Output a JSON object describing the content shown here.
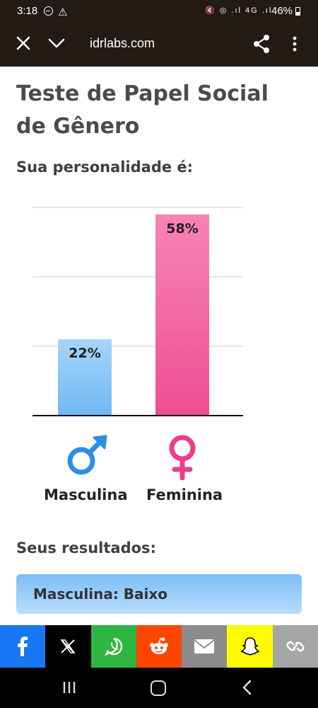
{
  "status_bar": {
    "time": "3:18",
    "alert_icon": "⚠",
    "system_icons": "🔇 ◎ .ıl 4G .ıl",
    "battery": "46%"
  },
  "browser": {
    "url": "idrlabs.com"
  },
  "page": {
    "title": "Teste de Papel Social de Gênero",
    "subtitle": "Sua personalidade é:",
    "results_heading": "Seus resultados:",
    "result_card": "Masculina: Baixo"
  },
  "chart_data": {
    "type": "bar",
    "categories": [
      "Masculina",
      "Feminina"
    ],
    "values": [
      22,
      58
    ],
    "value_labels": [
      "22%",
      "58%"
    ],
    "ylim": [
      0,
      100
    ],
    "grid": true,
    "bar_colors": [
      "#7fc3f7",
      "#f2669f"
    ],
    "icons": [
      "male-symbol-icon",
      "female-symbol-icon"
    ]
  },
  "share_bar": [
    {
      "name": "facebook",
      "icon": "f",
      "color": "#1877f2"
    },
    {
      "name": "x",
      "icon": "𝕏",
      "color": "#000000"
    },
    {
      "name": "whatsapp",
      "icon": "whatsapp-icon",
      "color": "#2db742"
    },
    {
      "name": "reddit",
      "icon": "reddit-icon",
      "color": "#ff4500"
    },
    {
      "name": "email",
      "icon": "envelope-icon",
      "color": "#8c8c8c"
    },
    {
      "name": "snapchat",
      "icon": "ghost-icon",
      "color": "#fffc00"
    },
    {
      "name": "copy-link",
      "icon": "link-icon",
      "color": "#a6a6a6"
    }
  ]
}
